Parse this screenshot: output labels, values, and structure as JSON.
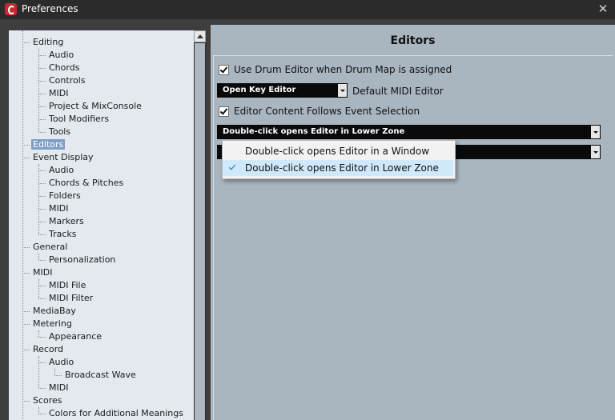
{
  "window": {
    "title": "Preferences"
  },
  "tree": [
    {
      "label": "Editing",
      "level": 1
    },
    {
      "label": "Audio",
      "level": 2
    },
    {
      "label": "Chords",
      "level": 2
    },
    {
      "label": "Controls",
      "level": 2
    },
    {
      "label": "MIDI",
      "level": 2
    },
    {
      "label": "Project & MixConsole",
      "level": 2
    },
    {
      "label": "Tool Modifiers",
      "level": 2
    },
    {
      "label": "Tools",
      "level": 2
    },
    {
      "label": "Editors",
      "level": 1,
      "selected": true
    },
    {
      "label": "Event Display",
      "level": 1
    },
    {
      "label": "Audio",
      "level": 2
    },
    {
      "label": "Chords & Pitches",
      "level": 2
    },
    {
      "label": "Folders",
      "level": 2
    },
    {
      "label": "MIDI",
      "level": 2
    },
    {
      "label": "Markers",
      "level": 2
    },
    {
      "label": "Tracks",
      "level": 2
    },
    {
      "label": "General",
      "level": 1
    },
    {
      "label": "Personalization",
      "level": 2
    },
    {
      "label": "MIDI",
      "level": 1
    },
    {
      "label": "MIDI File",
      "level": 2
    },
    {
      "label": "MIDI Filter",
      "level": 2
    },
    {
      "label": "MediaBay",
      "level": 1
    },
    {
      "label": "Metering",
      "level": 1
    },
    {
      "label": "Appearance",
      "level": 2
    },
    {
      "label": "Record",
      "level": 1
    },
    {
      "label": "Audio",
      "level": 2
    },
    {
      "label": "Broadcast Wave",
      "level": 3
    },
    {
      "label": "MIDI",
      "level": 2
    },
    {
      "label": "Scores",
      "level": 1
    },
    {
      "label": "Colors for Additional Meanings",
      "level": 2
    }
  ],
  "editors": {
    "title": "Editors",
    "drum_editor_label": "Use Drum Editor when Drum Map is assigned",
    "drum_editor_checked": true,
    "default_midi_editor_value": "Open Key Editor",
    "default_midi_editor_label": "Default MIDI Editor",
    "follow_selection_label": "Editor Content Follows Event Selection",
    "follow_selection_checked": true,
    "double_click_value": "Double-click opens Editor in Lower Zone"
  },
  "popup_menu": {
    "items": [
      {
        "label": "Double-click opens Editor in a Window",
        "checked": false
      },
      {
        "label": "Double-click opens Editor in Lower Zone",
        "checked": true
      }
    ]
  }
}
